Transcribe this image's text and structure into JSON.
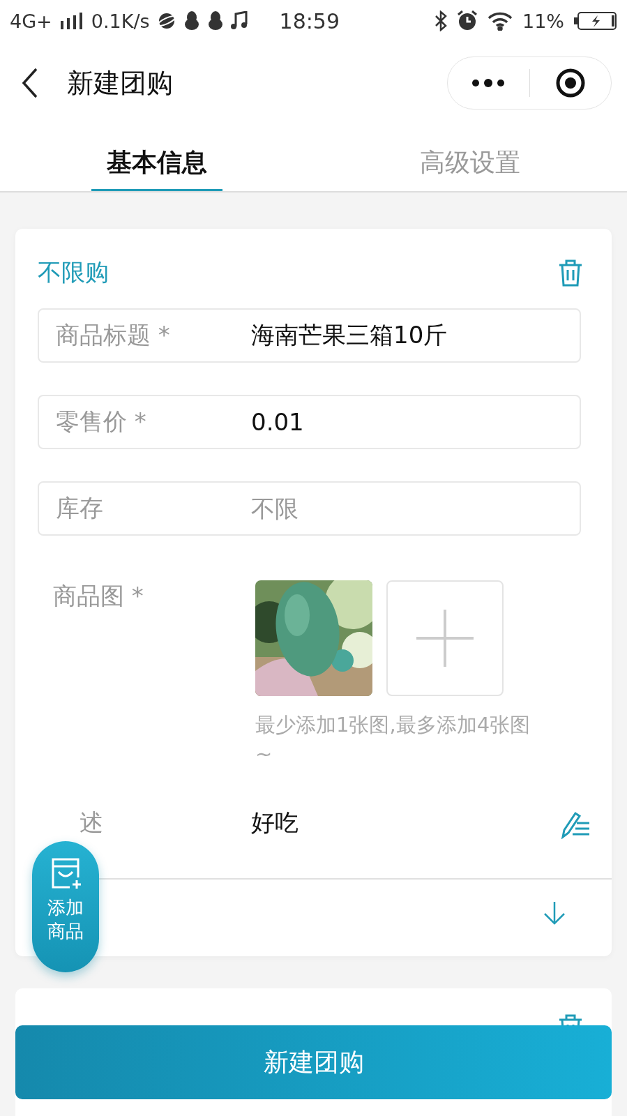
{
  "status_bar": {
    "network": "4G+",
    "speed": "0.1K/s",
    "time": "18:59",
    "battery": "11%"
  },
  "header": {
    "title": "新建团购"
  },
  "tabs": [
    {
      "label": "基本信息",
      "selected": true
    },
    {
      "label": "高级设置",
      "selected": false
    }
  ],
  "product": {
    "limit": "不限购",
    "fields": [
      {
        "label": "商品标题 *",
        "value": "海南芒果三箱10斤"
      },
      {
        "label": "零售价 *",
        "value": "0.01"
      },
      {
        "label": "库存",
        "placeholder": "不限"
      }
    ],
    "images_label": "商品图 *",
    "images_hint": "最少添加1张图,最多添加4张图~",
    "description": {
      "label": "述",
      "value": "好吃"
    }
  },
  "float_button": {
    "label": "添加商品"
  },
  "submit": {
    "label": "新建团购"
  }
}
